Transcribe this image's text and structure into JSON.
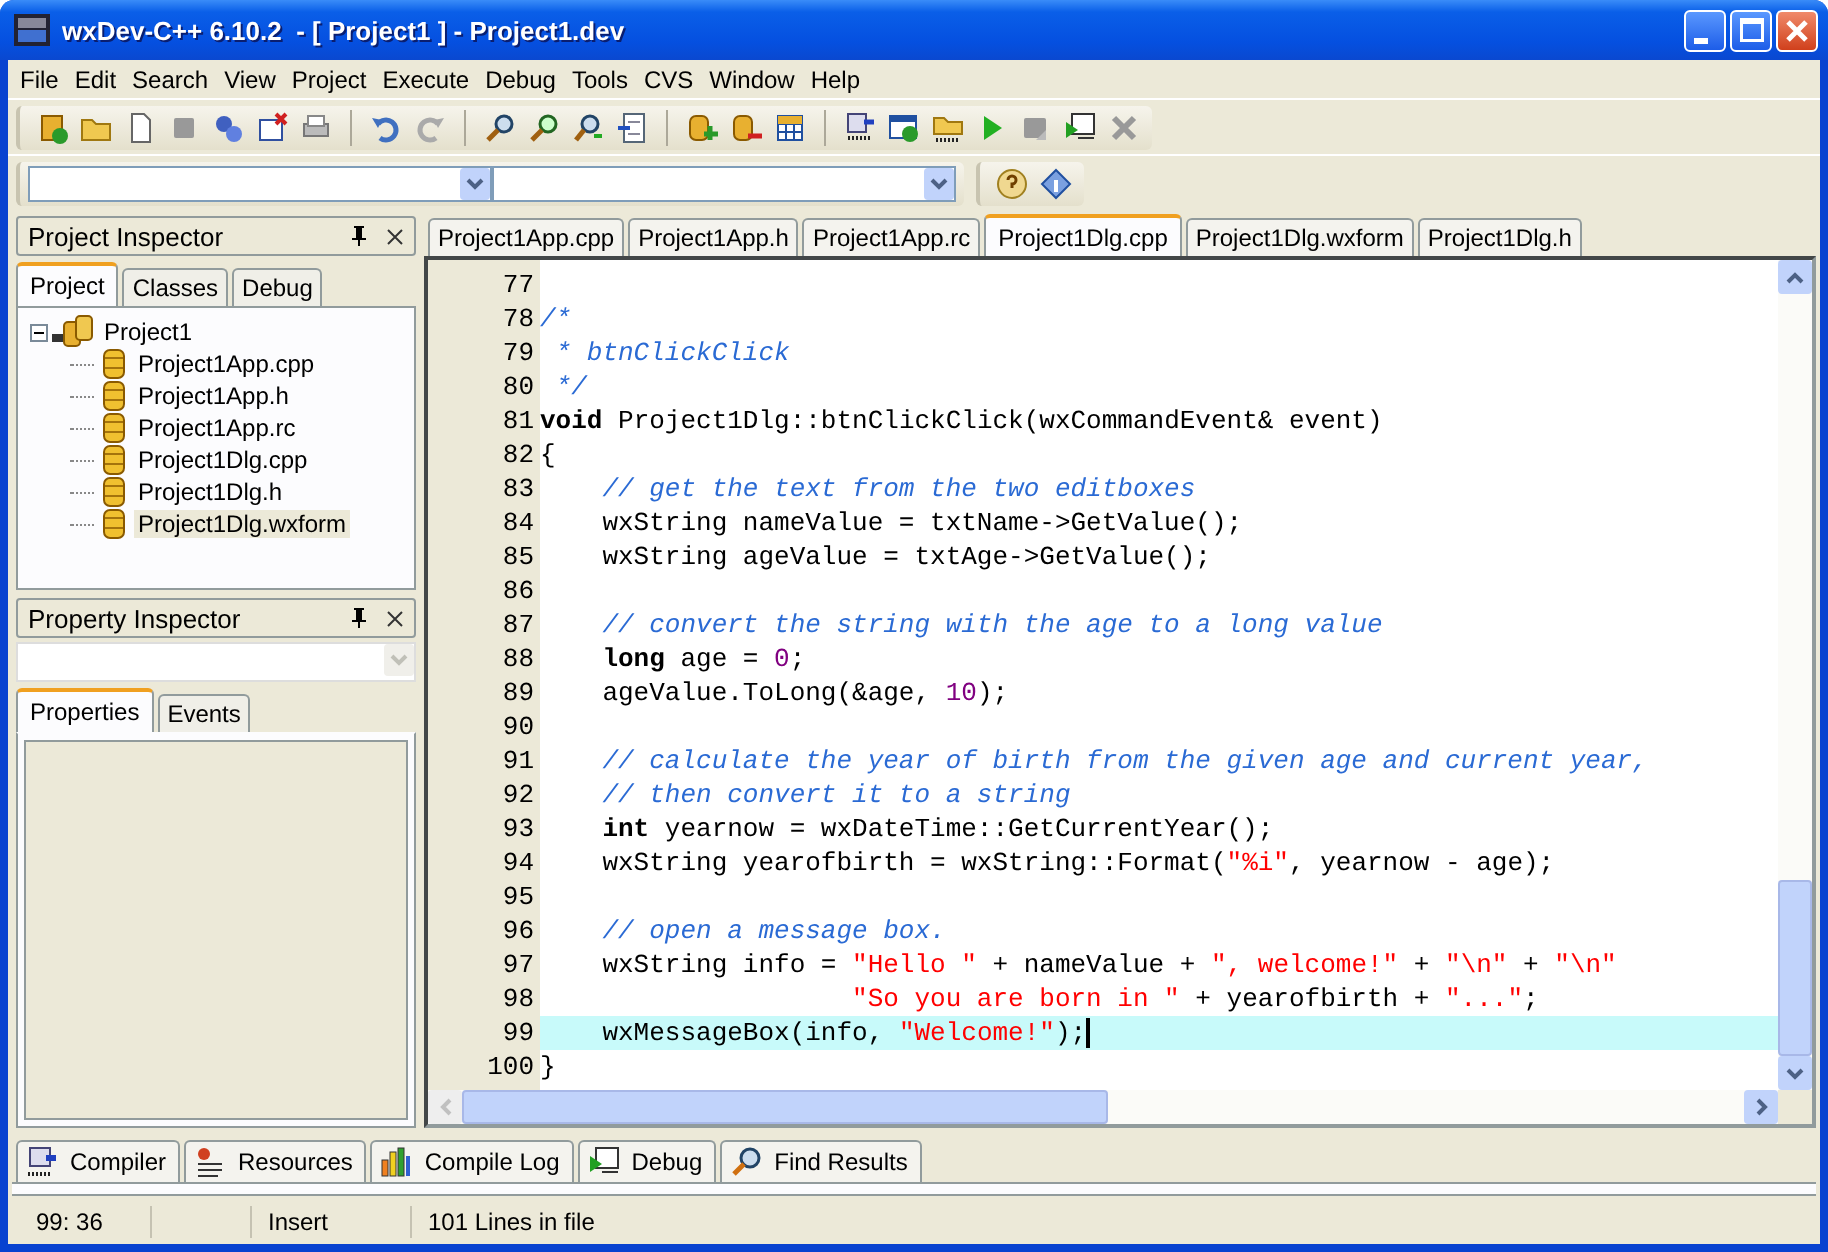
{
  "window": {
    "title": "wxDev-C++ 6.10.2  - [ Project1 ] - Project1.dev"
  },
  "menu": [
    "File",
    "Edit",
    "Search",
    "View",
    "Project",
    "Execute",
    "Debug",
    "Tools",
    "CVS",
    "Window",
    "Help"
  ],
  "project_inspector": {
    "title": "Project Inspector",
    "tabs": [
      {
        "label": "Project",
        "selected": true
      },
      {
        "label": "Classes",
        "selected": false
      },
      {
        "label": "Debug",
        "selected": false
      }
    ],
    "tree": [
      {
        "label": "Project1",
        "expanded": true,
        "selected": false,
        "children": [
          {
            "label": "Project1App.cpp",
            "selected": false
          },
          {
            "label": "Project1App.h",
            "selected": false
          },
          {
            "label": "Project1App.rc",
            "selected": false
          },
          {
            "label": "Project1Dlg.cpp",
            "selected": false
          },
          {
            "label": "Project1Dlg.h",
            "selected": false
          },
          {
            "label": "Project1Dlg.wxform",
            "selected": true
          }
        ]
      }
    ]
  },
  "property_inspector": {
    "title": "Property Inspector",
    "tabs": [
      {
        "label": "Properties",
        "selected": true
      },
      {
        "label": "Events",
        "selected": false
      }
    ]
  },
  "editor_tabs": [
    {
      "label": "Project1App.cpp",
      "selected": false
    },
    {
      "label": "Project1App.h",
      "selected": false
    },
    {
      "label": "Project1App.rc",
      "selected": false
    },
    {
      "label": "Project1Dlg.cpp",
      "selected": true
    },
    {
      "label": "Project1Dlg.wxform",
      "selected": false
    },
    {
      "label": "Project1Dlg.h",
      "selected": false
    }
  ],
  "code_lines": [
    {
      "number": "77",
      "current": false
    },
    {
      "number": "78",
      "current": false,
      "tokens": [
        {
          "kind": "comment",
          "text": "/*"
        }
      ]
    },
    {
      "number": "79",
      "current": false,
      "tokens": [
        {
          "kind": "comment",
          "text": " * btnClickClick"
        }
      ]
    },
    {
      "number": "80",
      "current": false,
      "tokens": [
        {
          "kind": "comment",
          "text": " */"
        }
      ]
    },
    {
      "number": "81",
      "current": false,
      "tokens": [
        {
          "kind": "keyword",
          "text": "void"
        },
        {
          "kind": "plain",
          "text": " Project1Dlg::btnClickClick(wxCommandEvent& event)"
        }
      ]
    },
    {
      "number": "82",
      "current": false,
      "tokens": [
        {
          "kind": "plain",
          "text": "{"
        }
      ]
    },
    {
      "number": "83",
      "current": false,
      "tokens": [
        {
          "kind": "comment",
          "text": "    // get the text from the two editboxes"
        }
      ]
    },
    {
      "number": "84",
      "current": false,
      "tokens": [
        {
          "kind": "plain",
          "text": "    wxString nameValue = txtName->GetValue();"
        }
      ]
    },
    {
      "number": "85",
      "current": false,
      "tokens": [
        {
          "kind": "plain",
          "text": "    wxString ageValue = txtAge->GetValue();"
        }
      ]
    },
    {
      "number": "86",
      "current": false
    },
    {
      "number": "87",
      "current": false,
      "tokens": [
        {
          "kind": "comment",
          "text": "    // convert the string with the age to a long value"
        }
      ]
    },
    {
      "number": "88",
      "current": false,
      "tokens": [
        {
          "kind": "keyword",
          "text": "    long"
        },
        {
          "kind": "plain",
          "text": " age = "
        },
        {
          "kind": "number",
          "text": "0"
        },
        {
          "kind": "plain",
          "text": ";"
        }
      ]
    },
    {
      "number": "89",
      "current": false,
      "tokens": [
        {
          "kind": "plain",
          "text": "    ageValue.ToLong(&age, "
        },
        {
          "kind": "number",
          "text": "10"
        },
        {
          "kind": "plain",
          "text": ");"
        }
      ]
    },
    {
      "number": "90",
      "current": false
    },
    {
      "number": "91",
      "current": false,
      "tokens": [
        {
          "kind": "comment",
          "text": "    // calculate the year of birth from the given age and current year,"
        }
      ]
    },
    {
      "number": "92",
      "current": false,
      "tokens": [
        {
          "kind": "comment",
          "text": "    // then convert it to a string"
        }
      ]
    },
    {
      "number": "93",
      "current": false,
      "tokens": [
        {
          "kind": "keyword",
          "text": "    int"
        },
        {
          "kind": "plain",
          "text": " yearnow = wxDateTime::GetCurrentYear();"
        }
      ]
    },
    {
      "number": "94",
      "current": false,
      "tokens": [
        {
          "kind": "plain",
          "text": "    wxString yearofbirth = wxString::Format("
        },
        {
          "kind": "string",
          "text": "\"%i\""
        },
        {
          "kind": "plain",
          "text": ", yearnow - age);"
        }
      ]
    },
    {
      "number": "95",
      "current": false
    },
    {
      "number": "96",
      "current": false,
      "tokens": [
        {
          "kind": "comment",
          "text": "    // open a message box."
        }
      ]
    },
    {
      "number": "97",
      "current": false,
      "tokens": [
        {
          "kind": "plain",
          "text": "    wxString info = "
        },
        {
          "kind": "string",
          "text": "\"Hello \""
        },
        {
          "kind": "plain",
          "text": " + nameValue + "
        },
        {
          "kind": "string",
          "text": "\", welcome!\""
        },
        {
          "kind": "plain",
          "text": " + "
        },
        {
          "kind": "string",
          "text": "\"\\n\""
        },
        {
          "kind": "plain",
          "text": " + "
        },
        {
          "kind": "string",
          "text": "\"\\n\""
        }
      ]
    },
    {
      "number": "98",
      "current": false,
      "tokens": [
        {
          "kind": "string",
          "text": "                    \"So you are born in \""
        },
        {
          "kind": "plain",
          "text": " + yearofbirth + "
        },
        {
          "kind": "string",
          "text": "\"...\""
        },
        {
          "kind": "plain",
          "text": ";"
        }
      ]
    },
    {
      "number": "99",
      "current": true,
      "tokens": [
        {
          "kind": "plain",
          "text": "    wxMessageBox(info, "
        },
        {
          "kind": "string",
          "text": "\"Welcome!\""
        },
        {
          "kind": "plain",
          "text": ");"
        }
      ]
    },
    {
      "number": "100",
      "current": false,
      "tokens": [
        {
          "kind": "plain",
          "text": "}"
        }
      ]
    }
  ],
  "bottom_tabs": [
    {
      "label": "Compiler",
      "selected": false
    },
    {
      "label": "Resources",
      "selected": false
    },
    {
      "label": "Compile Log",
      "selected": false
    },
    {
      "label": "Debug",
      "selected": false
    },
    {
      "label": "Find Results",
      "selected": false
    }
  ],
  "status_bar": {
    "position": "99: 36",
    "mode": "Insert",
    "info": "101 Lines in file"
  }
}
